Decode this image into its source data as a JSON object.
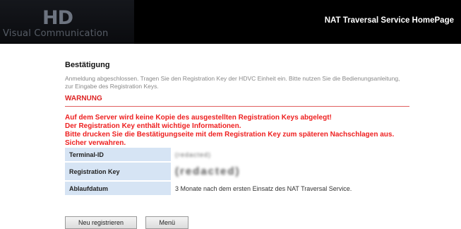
{
  "header": {
    "logo_mark": "HD",
    "logo_text": "Visual Communication",
    "homepage_link": "NAT Traversal Service HomePage"
  },
  "confirmation": {
    "title": "Bestätigung",
    "info": "Anmeldung abgeschlossen. Tragen Sie den Registration Key der HDVC Einheit ein. Bitte nutzen Sie die Bedienungsanleitung, zur Eingabe des Registration Keys."
  },
  "warning": {
    "title": "WARNUNG",
    "lines": [
      "Auf dem Server wird keine Kopie des ausgestellten Registration Keys abgelegt!",
      "Der Registration Key enthält wichtige Informationen.",
      "Bitte drucken Sie die Bestätigungseite mit dem Registration Key zum späteren Nachschlagen aus. Sicher verwahren."
    ]
  },
  "table": {
    "terminal_id_label": "Terminal-ID",
    "terminal_id_value": "(redacted)",
    "registration_key_label": "Registration Key",
    "registration_key_value": "(redacted)",
    "expiry_label": "Ablaufdatum",
    "expiry_value": "3 Monate nach dem ersten Einsatz des NAT Traversal Service."
  },
  "buttons": {
    "register_new": "Neu registrieren",
    "menu": "Menü"
  }
}
